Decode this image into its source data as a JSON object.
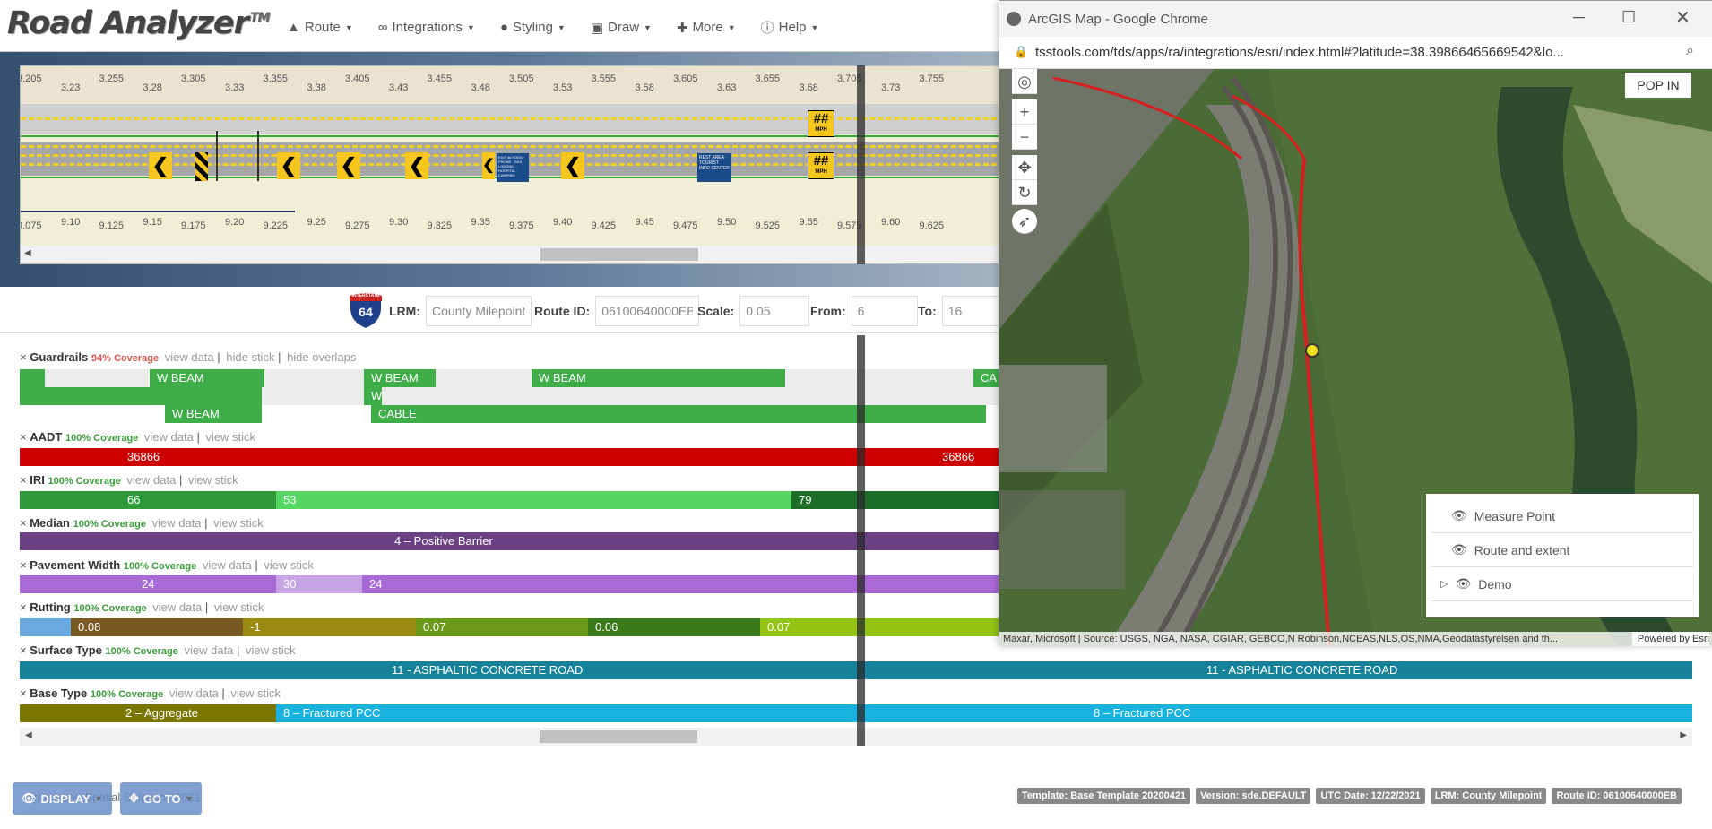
{
  "app": {
    "title": "Road Analyzer",
    "tm": "TM"
  },
  "nav": [
    {
      "label": "Route",
      "icon": "road-icon"
    },
    {
      "label": "Integrations",
      "icon": "link-icon"
    },
    {
      "label": "Styling",
      "icon": "drop-icon"
    },
    {
      "label": "Draw",
      "icon": "image-icon"
    },
    {
      "label": "More",
      "icon": "plus-icon"
    },
    {
      "label": "Help",
      "icon": "info-icon"
    }
  ],
  "stick": {
    "top_ruler": [
      {
        "major": "3.205",
        "minor": "3.23"
      },
      {
        "major": "3.255",
        "minor": "3.28"
      },
      {
        "major": "3.305",
        "minor": "3.33"
      },
      {
        "major": "3.355",
        "minor": "3.38"
      },
      {
        "major": "3.405",
        "minor": "3.43"
      },
      {
        "major": "3.455",
        "minor": "3.48"
      },
      {
        "major": "3.505",
        "minor": "3.53"
      },
      {
        "major": "3.555",
        "minor": "3.58"
      },
      {
        "major": "3.605",
        "minor": "3.63"
      },
      {
        "major": "3.655",
        "minor": "3.68"
      },
      {
        "major": "3.705",
        "minor": "3.73"
      },
      {
        "major": "3.755",
        "minor": ""
      }
    ],
    "bottom_ruler": [
      {
        "major": "9.075",
        "minor": "9.10"
      },
      {
        "major": "9.125",
        "minor": "9.15"
      },
      {
        "major": "9.175",
        "minor": "9.20"
      },
      {
        "major": "9.225",
        "minor": "9.25"
      },
      {
        "major": "9.275",
        "minor": "9.30"
      },
      {
        "major": "9.325",
        "minor": "9.35"
      },
      {
        "major": "9.375",
        "minor": "9.40"
      },
      {
        "major": "9.425",
        "minor": "9.45"
      },
      {
        "major": "9.475",
        "minor": "9.50"
      },
      {
        "major": "9.525",
        "minor": "9.55"
      },
      {
        "major": "9.575",
        "minor": "9.60"
      },
      {
        "major": "9.625",
        "minor": ""
      }
    ],
    "speed_sign_top": "##",
    "speed_sign_bottom": "##",
    "speed_unit": "MPH",
    "sign1": "EXIT ## FOOD · PHONE · GAS · LODGING · HOSPITAL · CAMPING",
    "sign2": "REST AREA · TOURIST INFO CENTER"
  },
  "lrm": {
    "route_shield": "64",
    "route_shield_top": "INTERSTATE",
    "lrm_label": "LRM:",
    "lrm_value": "County Milepoint",
    "route_label": "Route ID:",
    "route_value": "06100640000EB",
    "scale_label": "Scale:",
    "scale_value": "0.05",
    "from_label": "From:",
    "from_value": "6",
    "to_label": "To:",
    "to_value": "16"
  },
  "layers": [
    {
      "name": "Guardrails",
      "coverage": "94% Coverage",
      "cov_color": "#d9534f",
      "links": [
        "view data",
        "hide stick",
        "hide overlaps"
      ]
    },
    {
      "name": "AADT",
      "coverage": "100% Coverage",
      "cov_color": "#3c9a3c",
      "links": [
        "view data",
        "view stick"
      ]
    },
    {
      "name": "IRI",
      "coverage": "100% Coverage",
      "cov_color": "#3c9a3c",
      "links": [
        "view data",
        "view stick"
      ]
    },
    {
      "name": "Median",
      "coverage": "100% Coverage",
      "cov_color": "#3c9a3c",
      "links": [
        "view data",
        "view stick"
      ]
    },
    {
      "name": "Pavement Width",
      "coverage": "100% Coverage",
      "cov_color": "#3c9a3c",
      "links": [
        "view data",
        "view stick"
      ]
    },
    {
      "name": "Rutting",
      "coverage": "100% Coverage",
      "cov_color": "#3c9a3c",
      "links": [
        "view data",
        "view stick"
      ]
    },
    {
      "name": "Surface Type",
      "coverage": "100% Coverage",
      "cov_color": "#3c9a3c",
      "links": [
        "view data",
        "view stick"
      ]
    },
    {
      "name": "Base Type",
      "coverage": "100% Coverage",
      "cov_color": "#3c9a3c",
      "links": [
        "view data",
        "view stick"
      ]
    }
  ],
  "guardrail_labels": {
    "wb1": "W BEAM",
    "wb2": "W BEAM",
    "wb3": "W BEAM",
    "wb4": "W BEAM",
    "cable": "CABLE",
    "w": "W",
    "ca": "CA"
  },
  "aadt": {
    "seg1": "36866",
    "seg2": "36866",
    "color": "#cc0000"
  },
  "iri": {
    "seg1": "66",
    "seg2": "53",
    "seg3": "79"
  },
  "median": {
    "seg1": "4 – Positive Barrier",
    "color": "#6a4185"
  },
  "pavement": {
    "seg1": "24",
    "seg2": "30",
    "seg3": "24"
  },
  "rutting": {
    "seg1": "0.08",
    "seg2": "-1",
    "seg3": "0.07",
    "seg4": "0.06",
    "seg5": "0.07"
  },
  "surface": {
    "seg1": "11 - ASPHALTIC CONCRETE ROAD",
    "seg2": "11 - ASPHALTIC CONCRETE ROAD",
    "color": "#16829a"
  },
  "base": {
    "seg1": "2 – Aggregate",
    "seg2": "8 – Fractured PCC",
    "seg3": "8 – Fractured PCC"
  },
  "map": {
    "window_title": "ArcGIS Map - Google Chrome",
    "url": "tsstools.com/tds/apps/ra/integrations/esri/index.html#?latitude=38.39866465669542&lo...",
    "pop_in": "POP IN",
    "legend": [
      "Measure Point",
      "Route and extent",
      "Demo"
    ],
    "attribution": "Maxar, Microsoft | Source: USGS, NGA, NASA, CGIAR, GEBCO,N Robinson,NCEAS,NLS,OS,NMA,Geodatastyrelsen and th...",
    "powered": "Powered by Esri"
  },
  "footer": {
    "display_btn": "DISPLAY",
    "goto_btn": "GO TO",
    "copyright": "Transcend Spatial Solutions 2021",
    "badges": [
      "Template: Base Template 20200421",
      "Version: sde.DEFAULT",
      "UTC Date: 12/22/2021",
      "LRM: County Milepoint",
      "Route ID: 06100640000EB"
    ]
  }
}
